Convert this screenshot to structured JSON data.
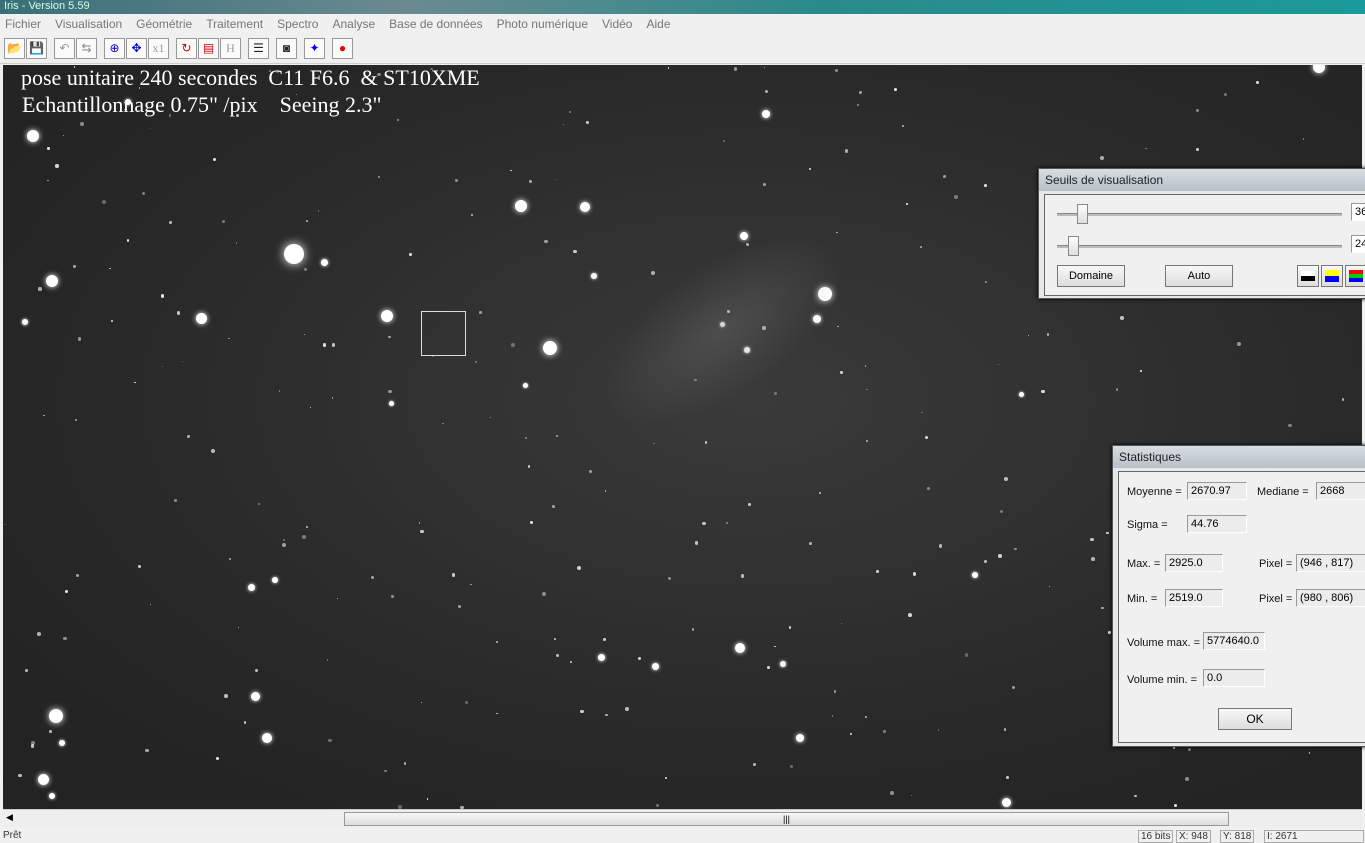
{
  "window": {
    "title": "Iris - Version 5.59"
  },
  "menu": [
    "Fichier",
    "Visualisation",
    "Géométrie",
    "Traitement",
    "Spectro",
    "Analyse",
    "Base de données",
    "Photo numérique",
    "Vidéo",
    "Aide"
  ],
  "toolbar": [
    {
      "icon": "open-folder-icon",
      "glyph": "📂"
    },
    {
      "icon": "save-icon",
      "glyph": "💾"
    },
    null,
    {
      "icon": "undo-icon",
      "glyph": "↶"
    },
    {
      "icon": "adjust-icon",
      "glyph": "⇆"
    },
    null,
    {
      "icon": "zoom-in-icon",
      "glyph": "⊕"
    },
    {
      "icon": "zoom-out-icon",
      "glyph": "✥"
    },
    {
      "icon": "zoom-1x-icon",
      "glyph": "x1"
    },
    null,
    {
      "icon": "rotate-icon",
      "glyph": "↻"
    },
    {
      "icon": "palette-icon",
      "glyph": "▤"
    },
    {
      "icon": "histogram-icon",
      "glyph": "H"
    },
    null,
    {
      "icon": "list-icon",
      "glyph": "☰"
    },
    null,
    {
      "icon": "camera-icon",
      "glyph": "◙"
    },
    null,
    {
      "icon": "star-blue-icon",
      "glyph": "✦"
    },
    null,
    {
      "icon": "record-icon",
      "glyph": "●"
    }
  ],
  "image": {
    "caption_line1": "pose unitaire 240 secondes  C11 F6.6  & ST10XME",
    "caption_line2": "Echantillonnage 0.75\" /pix    Seeing 2.3\""
  },
  "thresholds": {
    "title": "Seuils de visualisation",
    "high": "36",
    "low": "24",
    "high_level": 0.07,
    "low_level": 0.04,
    "domain_label": "Domaine",
    "auto_label": "Auto"
  },
  "stats": {
    "title": "Statistiques",
    "mean_label": "Moyenne =",
    "mean": "2670.97",
    "median_label": "Mediane =",
    "median": "2668",
    "sigma_label": "Sigma =",
    "sigma": "44.76",
    "max_label": "Max. =",
    "max": "2925.0",
    "max_pixel_label": "Pixel =",
    "max_pixel": "(946 , 817)",
    "min_label": "Min. =",
    "min": "2519.0",
    "min_pixel_label": "Pixel =",
    "min_pixel": "(980 , 806)",
    "vol_max_label": "Volume max. =",
    "vol_max": "5774640.0",
    "vol_min_label": "Volume min. =",
    "vol_min": "0.0",
    "ok_label": "OK"
  },
  "status": {
    "left": "Prêt",
    "bits": "16 bits",
    "x": "X: 948",
    "y": "Y: 818",
    "i": "I: 2671"
  }
}
